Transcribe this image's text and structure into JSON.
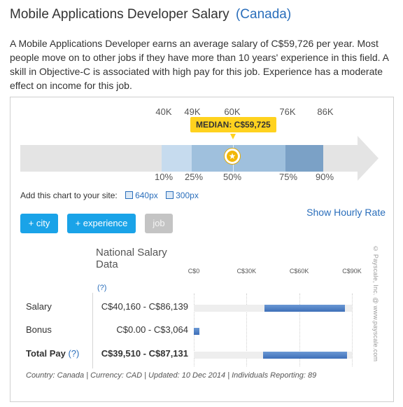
{
  "header": {
    "title": "Mobile Applications Developer Salary",
    "location": "(Canada)"
  },
  "description": "A Mobile Applications Developer earns an average salary of C$59,726 per year. Most people move on to other jobs if they have more than 10 years' experience in this field. A skill in Objective-C is associated with high pay for this job. Experience has a moderate effect on income for this job.",
  "percentile_chart": {
    "top_labels": [
      "40K",
      "49K",
      "60K",
      "76K",
      "86K"
    ],
    "bottom_labels": [
      "10%",
      "25%",
      "50%",
      "75%",
      "90%"
    ],
    "median_label": "MEDIAN: C$59,725",
    "median_icon": "star-icon",
    "colors": {
      "band_light": "#c6dbee",
      "band_mid": "#9fc0dd",
      "band_dark": "#7ba1c6",
      "median": "#ffd21f"
    }
  },
  "add_chart": {
    "label": "Add this chart to your site:",
    "link_640": "640px",
    "link_300": "300px"
  },
  "hourly_link": "Show Hourly Rate",
  "filters": {
    "city": "+ city",
    "experience": "+ experience",
    "job": "job"
  },
  "national": {
    "title": "National Salary Data",
    "help": "(?)",
    "axis": [
      "C$0",
      "C$30K",
      "C$60K",
      "C$90K"
    ],
    "rows": [
      {
        "label": "Salary",
        "help": "",
        "value": "C$40,160 - C$86,139",
        "range": [
          40160,
          86139
        ]
      },
      {
        "label": "Bonus",
        "help": "",
        "value": "C$0.00 - C$3,064",
        "range": [
          0,
          3064
        ]
      },
      {
        "label": "Total Pay",
        "help": "(?)",
        "value": "C$39,510 - C$87,131",
        "range": [
          39510,
          87131
        ]
      }
    ],
    "axis_max": 90000
  },
  "footer": "Country: Canada | Currency: CAD | Updated: 10 Dec 2014 | Individuals Reporting: 89",
  "watermark": "© Payscale, Inc. @ www.payscale.com"
}
